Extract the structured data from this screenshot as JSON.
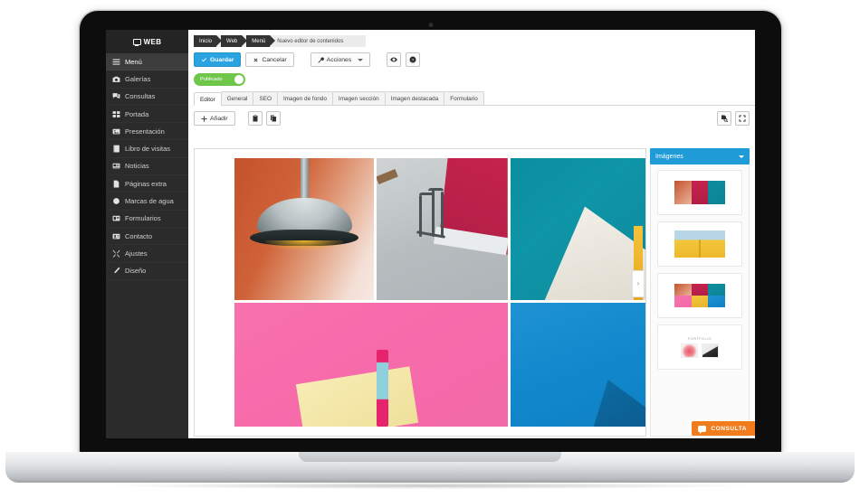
{
  "sidebar": {
    "brand": "WEB",
    "brand_icon": "monitor-icon",
    "items": [
      {
        "label": "Menú",
        "icon": "hamburger-icon",
        "active": true
      },
      {
        "label": "Galerías",
        "icon": "camera-icon",
        "active": false
      },
      {
        "label": "Consultas",
        "icon": "chat-icon",
        "active": false
      },
      {
        "label": "Portada",
        "icon": "grid-icon",
        "active": false
      },
      {
        "label": "Presentación",
        "icon": "image-icon",
        "active": false
      },
      {
        "label": "Libro de visitas",
        "icon": "book-icon",
        "active": false
      },
      {
        "label": "Noticias",
        "icon": "newspaper-icon",
        "active": false
      },
      {
        "label": "Páginas extra",
        "icon": "file-icon",
        "active": false
      },
      {
        "label": "Marcas de agua",
        "icon": "droplet-icon",
        "active": false
      },
      {
        "label": "Formularios",
        "icon": "form-icon",
        "active": false
      },
      {
        "label": "Contacto",
        "icon": "contact-card-icon",
        "active": false
      },
      {
        "label": "Ajustes",
        "icon": "tools-icon",
        "active": false
      },
      {
        "label": "Diseño",
        "icon": "brush-icon",
        "active": false
      }
    ]
  },
  "breadcrumb": {
    "items": [
      "Inicio",
      "Web",
      "Menú"
    ],
    "current": "Nuevo editor de contenidos"
  },
  "toolbar": {
    "save_label": "Guardar",
    "cancel_label": "Cancelar",
    "actions_label": "Acciones",
    "preview_icon": "eye-icon",
    "help_icon": "question-icon"
  },
  "publish": {
    "label": "Publicado",
    "state": "on",
    "color": "#6ec64b"
  },
  "tabs": [
    {
      "label": "Editor",
      "active": true
    },
    {
      "label": "General",
      "active": false
    },
    {
      "label": "SEO",
      "active": false
    },
    {
      "label": "Imagen de fondo",
      "active": false
    },
    {
      "label": "Imagen sección",
      "active": false
    },
    {
      "label": "Imagen destacada",
      "active": false
    },
    {
      "label": "Formulario",
      "active": false
    }
  ],
  "editor_bar": {
    "add_label": "Añadir",
    "paste_icon": "paste-icon",
    "copy_icon": "copy-icon",
    "preview_page_icon": "page-search-icon",
    "fullscreen_icon": "expand-icon"
  },
  "canvas": {
    "next_arrow": "›",
    "photos": [
      {
        "name": "pendant-lamp-orange"
      },
      {
        "name": "bike-rack-red-wall"
      },
      {
        "name": "teal-white-wedge"
      },
      {
        "name": "pink-notepad-pen"
      },
      {
        "name": "blue-plane-wing"
      }
    ]
  },
  "images_panel": {
    "title": "Imágenes",
    "accent": "#1f9bd8",
    "thumbnails": [
      {
        "name": "thumb-triptych"
      },
      {
        "name": "thumb-yellow-wall"
      },
      {
        "name": "thumb-six-grid"
      },
      {
        "name": "thumb-portfolio",
        "caption": "PORTFOLIO"
      }
    ]
  },
  "consulta": {
    "label": "CONSULTA",
    "icon": "chat-bubble-icon",
    "color": "#f07c1d"
  }
}
